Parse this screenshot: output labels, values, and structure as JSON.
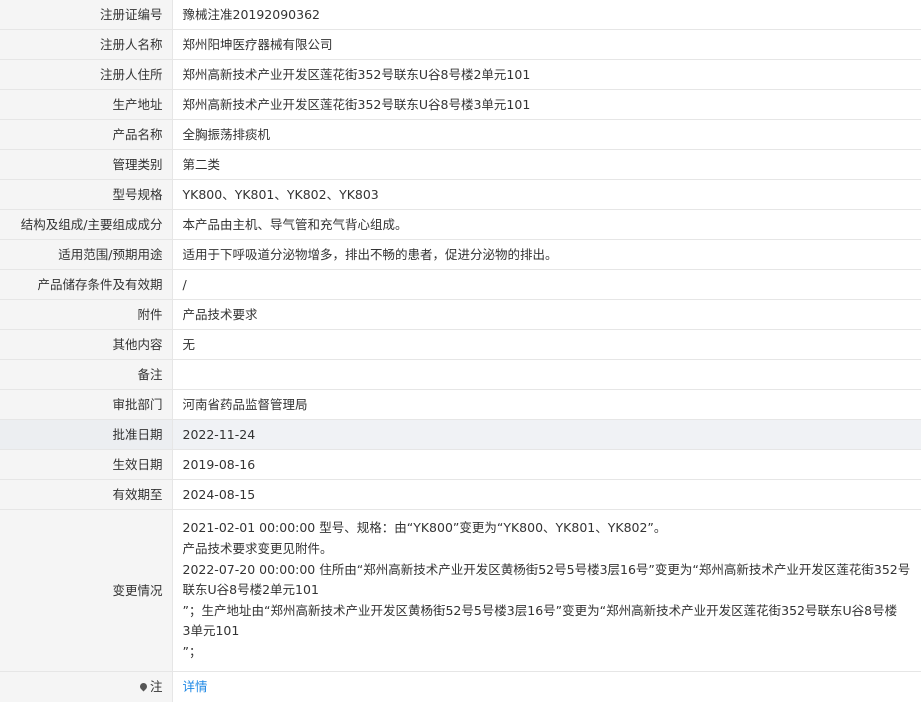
{
  "rows": [
    {
      "label": "注册证编号",
      "value": "豫械注准20192090362"
    },
    {
      "label": "注册人名称",
      "value": "郑州阳坤医疗器械有限公司"
    },
    {
      "label": "注册人住所",
      "value": "郑州高新技术产业开发区莲花街352号联东U谷8号楼2单元101"
    },
    {
      "label": "生产地址",
      "value": "郑州高新技术产业开发区莲花街352号联东U谷8号楼3单元101"
    },
    {
      "label": "产品名称",
      "value": "全胸振荡排痰机"
    },
    {
      "label": "管理类别",
      "value": "第二类"
    },
    {
      "label": "型号规格",
      "value": "YK800、YK801、YK802、YK803"
    },
    {
      "label": "结构及组成/主要组成成分",
      "value": "本产品由主机、导气管和充气背心组成。"
    },
    {
      "label": "适用范围/预期用途",
      "value": "适用于下呼吸道分泌物增多，排出不畅的患者，促进分泌物的排出。"
    },
    {
      "label": "产品储存条件及有效期",
      "value": "/"
    },
    {
      "label": "附件",
      "value": "产品技术要求"
    },
    {
      "label": "其他内容",
      "value": "无"
    },
    {
      "label": "备注",
      "value": ""
    },
    {
      "label": "审批部门",
      "value": "河南省药品监督管理局"
    },
    {
      "label": "批准日期",
      "value": "2022-11-24"
    },
    {
      "label": "生效日期",
      "value": "2019-08-16"
    },
    {
      "label": "有效期至",
      "value": "2024-08-15"
    }
  ],
  "changes": {
    "label": "变更情况",
    "lines": [
      "2021-02-01 00:00:00 型号、规格：由“YK800”变更为“YK800、YK801、YK802”。",
      "产品技术要求变更见附件。",
      "2022-07-20 00:00:00 住所由“郑州高新技术产业开发区黄杨街52号5号楼3层16号”变更为“郑州高新技术产业开发区莲花街352号",
      "联东U谷8号楼2单元101",
      "”；生产地址由“郑州高新技术产业开发区黄杨街52号5号楼3层16号”变更为“郑州高新技术产业开发区莲花街352号联东U谷8号楼",
      "3单元101",
      "”；"
    ]
  },
  "note": {
    "label": "注",
    "icon": "map-pin-icon",
    "link_text": "详情",
    "link_color": "#1e88e5"
  }
}
